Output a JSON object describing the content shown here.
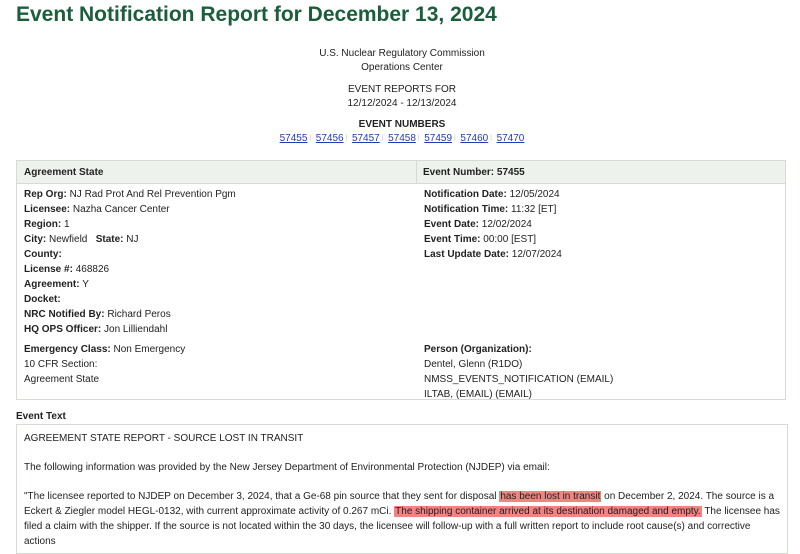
{
  "page": {
    "title": "Event Notification Report for December 13, 2024"
  },
  "header": {
    "agency": "U.S. Nuclear Regulatory Commission",
    "center": "Operations Center",
    "reports_for_label": "EVENT REPORTS FOR",
    "date_range": "12/12/2024 - 12/13/2024",
    "event_numbers_label": "EVENT NUMBERS",
    "event_numbers": [
      "57455",
      "57456",
      "57457",
      "57458",
      "57459",
      "57460",
      "57470"
    ]
  },
  "event": {
    "category": "Agreement State",
    "event_number_label": "Event Number:",
    "event_number": "57455",
    "left_fields": [
      {
        "label": "Rep Org:",
        "value": "NJ Rad Prot And Rel Prevention Pgm"
      },
      {
        "label": "Licensee:",
        "value": "Nazha Cancer Center"
      },
      {
        "label": "Region:",
        "value": "1"
      },
      {
        "label": "City:",
        "value": "Newfield"
      },
      {
        "label": "State:",
        "value": "NJ"
      },
      {
        "label": "County:",
        "value": ""
      },
      {
        "label": "License #:",
        "value": "468826"
      },
      {
        "label": "Agreement:",
        "value": "Y"
      },
      {
        "label": "Docket:",
        "value": ""
      },
      {
        "label": "NRC Notified By:",
        "value": "Richard Peros"
      },
      {
        "label": "HQ OPS Officer:",
        "value": "Jon Lilliendahl"
      }
    ],
    "right_fields": [
      {
        "label": "Notification Date:",
        "value": "12/05/2024"
      },
      {
        "label": "Notification Time:",
        "value": "11:32 [ET]"
      },
      {
        "label": "Event Date:",
        "value": "12/02/2024"
      },
      {
        "label": "Event Time:",
        "value": "00:00 [EST]"
      },
      {
        "label": "Last Update Date:",
        "value": "12/07/2024"
      }
    ],
    "emergency_class_label": "Emergency Class:",
    "emergency_class": "Non Emergency",
    "cfr_section_label": "10 CFR Section:",
    "cfr_section": "Agreement State",
    "person_org_label": "Person (Organization):",
    "persons": [
      "Dentel, Glenn (R1DO)",
      "NMSS_EVENTS_NOTIFICATION (EMAIL)",
      "ILTAB, (EMAIL) (EMAIL)"
    ]
  },
  "event_text": {
    "label": "Event Text",
    "heading": "AGREEMENT STATE REPORT - SOURCE LOST IN TRANSIT",
    "intro": "The following information was provided by the New Jersey Department of Environmental Protection (NJDEP) via email:",
    "p1": "\"The licensee reported to NJDEP on December 3, 2024, that a Ge-68 pin source that they sent for disposal ",
    "h1": "has been lost in transit",
    "p2": " on December 2, 2024. The source is a Eckert & Ziegler model HEGL-0132, with current approximate activity of 0.267 mCi. ",
    "h2": "The shipping container arrived at its destination damaged and empty.",
    "p3": " The licensee has filed a claim with the shipper. If the source is not located within the 30 days, the licensee will follow-up with a full written report to include root cause(s) and corrective actions"
  },
  "colors": {
    "title_green": "#1b5e3b",
    "header_bg": "#edf2ec",
    "highlight": "#f08480",
    "link": "#1a3fb0"
  }
}
